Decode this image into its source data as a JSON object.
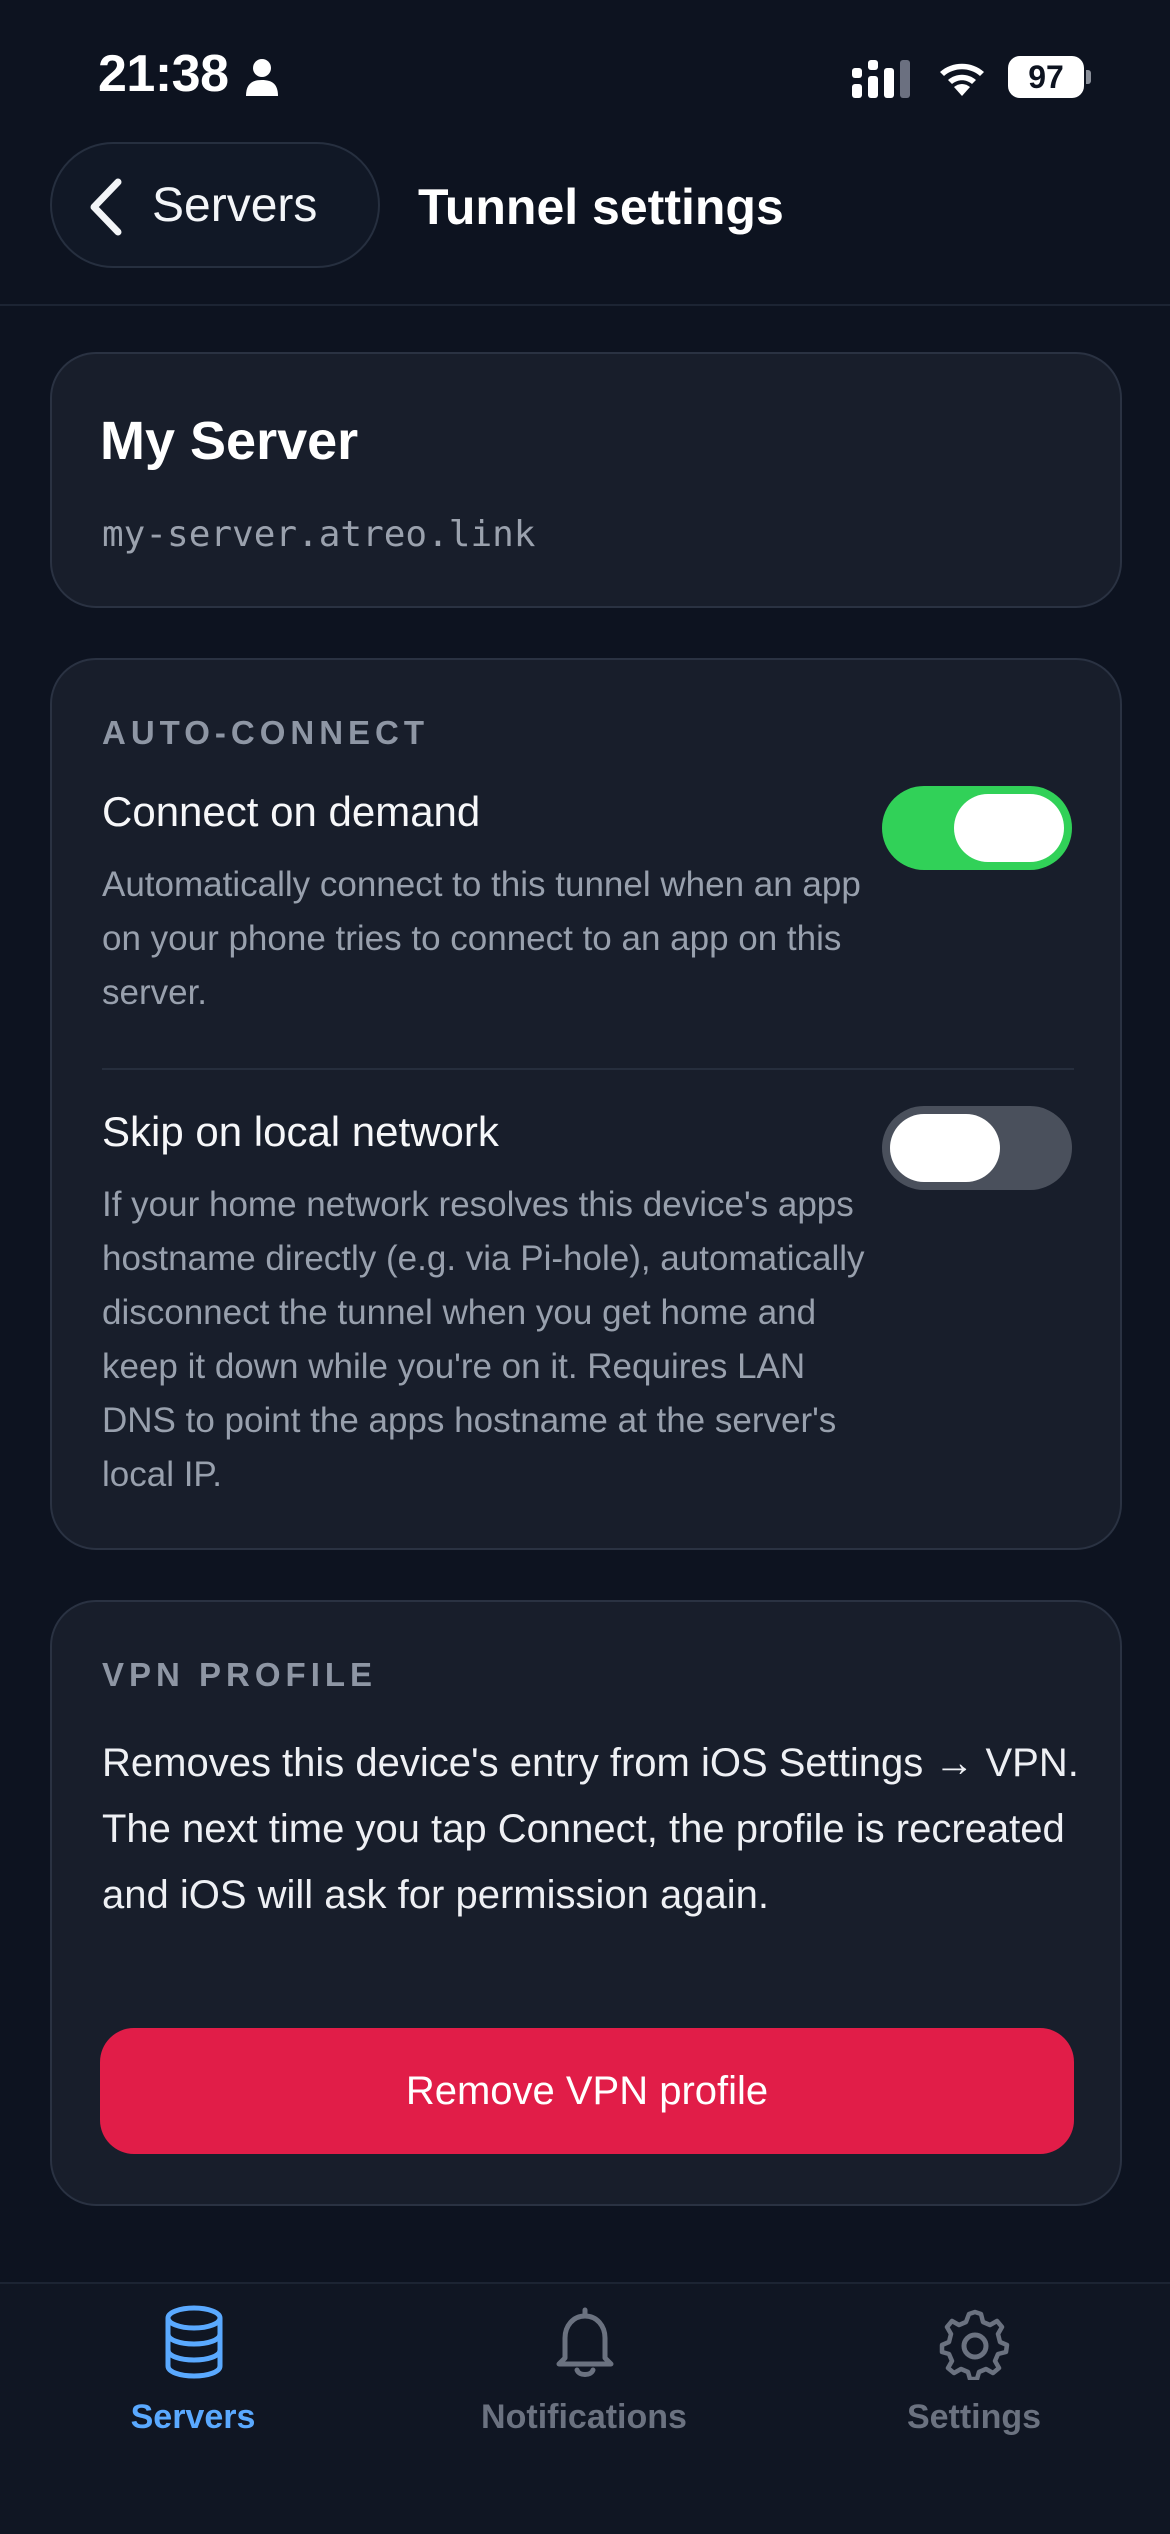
{
  "status_bar": {
    "time": "21:38",
    "battery": "97"
  },
  "header": {
    "back_label": "Servers",
    "title": "Tunnel settings"
  },
  "server": {
    "name": "My Server",
    "hostname": "my-server.atreo.link"
  },
  "auto_connect": {
    "section_label": "AUTO-CONNECT",
    "connect_on_demand": {
      "title": "Connect on demand",
      "description": "Automatically connect to this tunnel when an app on your phone tries to connect to an app on this server.",
      "enabled": true
    },
    "skip_local": {
      "title": "Skip on local network",
      "description": "If your home network resolves this device's apps hostname directly (e.g. via Pi-hole), automatically disconnect the tunnel when you get home and keep it down while you're on it. Requires LAN DNS to point the apps hostname at the server's local IP.",
      "enabled": false
    }
  },
  "vpn_profile": {
    "section_label": "VPN PROFILE",
    "description": "Removes this device's entry from iOS Settings → VPN. The next time you tap Connect, the profile is recreated and iOS will ask for permission again.",
    "button_label": "Remove VPN profile"
  },
  "tab_bar": {
    "tabs": [
      {
        "label": "Servers",
        "icon": "database-icon",
        "active": true
      },
      {
        "label": "Notifications",
        "icon": "bell-icon",
        "active": false
      },
      {
        "label": "Settings",
        "icon": "gear-icon",
        "active": false
      }
    ]
  },
  "colors": {
    "background": "#0d1320",
    "card": "#181e2b",
    "toggle_on": "#31d158",
    "toggle_off": "#4a505c",
    "danger": "#e11d48",
    "active_tab": "#5aa9ff",
    "inactive_tab": "#6b7280"
  }
}
